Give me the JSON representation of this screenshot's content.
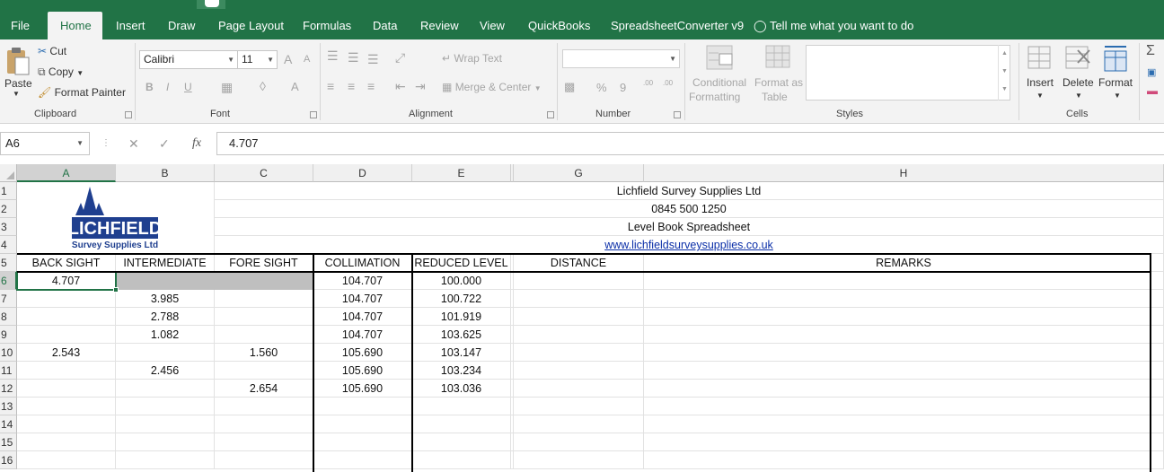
{
  "ribbon_tabs": [
    "File",
    "Home",
    "Insert",
    "Draw",
    "Page Layout",
    "Formulas",
    "Data",
    "Review",
    "View",
    "QuickBooks",
    "SpreadsheetConverter v9"
  ],
  "active_tab": "Home",
  "tell_me": "Tell me what you want to do",
  "clipboard": {
    "paste": "Paste",
    "cut": "Cut",
    "copy": "Copy",
    "format_painter": "Format Painter",
    "label": "Clipboard"
  },
  "font": {
    "name": "Calibri",
    "size": "11",
    "bold": "B",
    "italic": "I",
    "underline": "U",
    "grow": "A",
    "shrink": "A",
    "color": "A",
    "label": "Font"
  },
  "alignment": {
    "wrap_text": "Wrap Text",
    "merge_center": "Merge & Center",
    "label": "Alignment"
  },
  "number": {
    "format": "",
    "percent": "%",
    "comma": "9",
    "label": "Number",
    "inc_decimal": ".00",
    "dec_decimal": ".00"
  },
  "styles": {
    "conditional": "Conditional",
    "conditional2": "Formatting",
    "format_as": "Format as",
    "format_as2": "Table",
    "label": "Styles"
  },
  "cells": {
    "insert": "Insert",
    "delete": "Delete",
    "format": "Format",
    "label": "Cells"
  },
  "name_box": "A6",
  "formula": "4.707",
  "fx": "fx",
  "columns": [
    "A",
    "B",
    "C",
    "D",
    "E",
    "",
    "G",
    "H"
  ],
  "rows": [
    "1",
    "2",
    "3",
    "4",
    "5",
    "6",
    "7",
    "8",
    "9",
    "10",
    "11",
    "12",
    "13",
    "14",
    "15",
    "16"
  ],
  "logo": {
    "line1": "LICHFIELD",
    "line2": "Survey Supplies Ltd"
  },
  "header_block": {
    "company": "Lichfield Survey Supplies Ltd",
    "phone": "0845 500 1250",
    "title": "Level Book Spreadsheet",
    "website": "www.lichfieldsurveysupplies.co.uk"
  },
  "table_headers": [
    "BACK SIGHT",
    "INTERMEDIATE",
    "FORE SIGHT",
    "COLLIMATION",
    "REDUCED LEVEL",
    "DISTANCE",
    "REMARKS"
  ],
  "table_rows": [
    {
      "bs": "4.707",
      "is": "",
      "fs": "",
      "col": "104.707",
      "rl": "100.000"
    },
    {
      "bs": "",
      "is": "3.985",
      "fs": "",
      "col": "104.707",
      "rl": "100.722"
    },
    {
      "bs": "",
      "is": "2.788",
      "fs": "",
      "col": "104.707",
      "rl": "101.919"
    },
    {
      "bs": "",
      "is": "1.082",
      "fs": "",
      "col": "104.707",
      "rl": "103.625"
    },
    {
      "bs": "2.543",
      "is": "",
      "fs": "1.560",
      "col": "105.690",
      "rl": "103.147"
    },
    {
      "bs": "",
      "is": "2.456",
      "fs": "",
      "col": "105.690",
      "rl": "103.234"
    },
    {
      "bs": "",
      "is": "",
      "fs": "2.654",
      "col": "105.690",
      "rl": "103.036"
    }
  ],
  "colors": {
    "excel_green": "#217346",
    "logo_blue": "#1f3f8f"
  }
}
